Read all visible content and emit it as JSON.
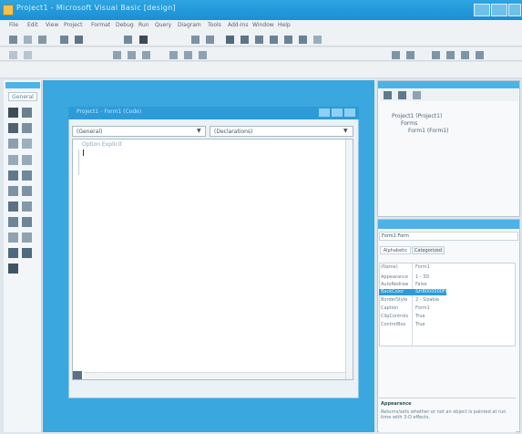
{
  "window": {
    "title": "Project1 - Microsoft Visual Basic [design]"
  },
  "menu": {
    "items": [
      "File",
      "Edit",
      "View",
      "Project",
      "Format",
      "Debug",
      "Run",
      "Query",
      "Diagram",
      "Tools",
      "Add-Ins",
      "Window",
      "Help"
    ]
  },
  "toolbox": {
    "tab_label": "General"
  },
  "code_window": {
    "title": "Project1 - Form1 (Code)",
    "object_combo": "(General)",
    "procedure_combo": "(Declarations)",
    "code_line1": "Option Explicit"
  },
  "project_explorer": {
    "root": "Project1 (Project1)",
    "folder": "Forms",
    "item": "Form1 (Form1)"
  },
  "properties": {
    "object": "Form1 Form",
    "tabs": [
      "Alphabetic",
      "Categorized"
    ],
    "header": [
      "(Name)",
      "Form1"
    ],
    "rows": [
      [
        "Appearance",
        "1 - 3D"
      ],
      [
        "AutoRedraw",
        "False"
      ],
      [
        "BackColor",
        "&H8000000F&"
      ],
      [
        "BorderStyle",
        "2 - Sizable"
      ],
      [
        "Caption",
        "Form1"
      ],
      [
        "ClipControls",
        "True"
      ],
      [
        "ControlBox",
        "True"
      ]
    ],
    "desc_title": "Appearance",
    "desc_text": "Returns/sets whether or not an object is painted at run time with 3-D effects."
  },
  "colors": {
    "accent": "#2ea5e2",
    "mdi_background": "#3aa7df",
    "selected_row": "#2d9bd8"
  }
}
